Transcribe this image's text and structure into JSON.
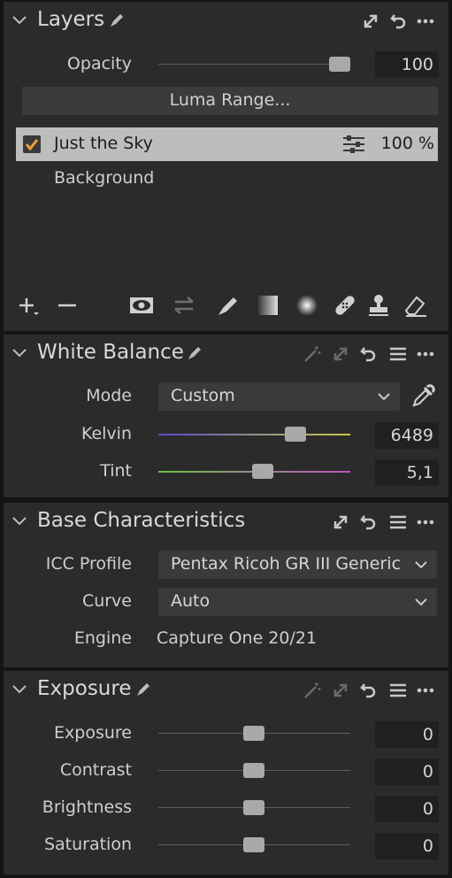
{
  "layers": {
    "title": "Layers",
    "opacity_label": "Opacity",
    "opacity_value": "100",
    "opacity_level": 0.88,
    "luma_button": "Luma Range...",
    "items": [
      {
        "name": "Just the Sky",
        "checked": true,
        "amount": "100 %",
        "selected": true
      },
      {
        "name": "Background",
        "checked": false,
        "amount": "",
        "selected": false
      }
    ],
    "tools": [
      "add-layer",
      "remove-layer",
      "eye",
      "swap",
      "brush",
      "gradient",
      "radial",
      "healing",
      "clone-stamp",
      "eraser"
    ]
  },
  "white_balance": {
    "title": "White Balance",
    "mode_label": "Mode",
    "mode_value": "Custom",
    "kelvin_label": "Kelvin",
    "kelvin_value": "6489",
    "kelvin_level": 0.71,
    "tint_label": "Tint",
    "tint_value": "5,1",
    "tint_level": 0.54
  },
  "base_characteristics": {
    "title": "Base Characteristics",
    "icc_label": "ICC Profile",
    "icc_value": "Pentax Ricoh GR III Generic",
    "curve_label": "Curve",
    "curve_value": "Auto",
    "engine_label": "Engine",
    "engine_value": "Capture One 20/21"
  },
  "exposure": {
    "title": "Exposure",
    "rows": [
      {
        "label": "Exposure",
        "value": "0",
        "level": 0.5
      },
      {
        "label": "Contrast",
        "value": "0",
        "level": 0.5
      },
      {
        "label": "Brightness",
        "value": "0",
        "level": 0.5
      },
      {
        "label": "Saturation",
        "value": "0",
        "level": 0.5
      }
    ]
  },
  "colors": {
    "accent_check": "#f0a23a",
    "selected_row": "#bdbdbd",
    "panel": "#2b2b2b"
  }
}
